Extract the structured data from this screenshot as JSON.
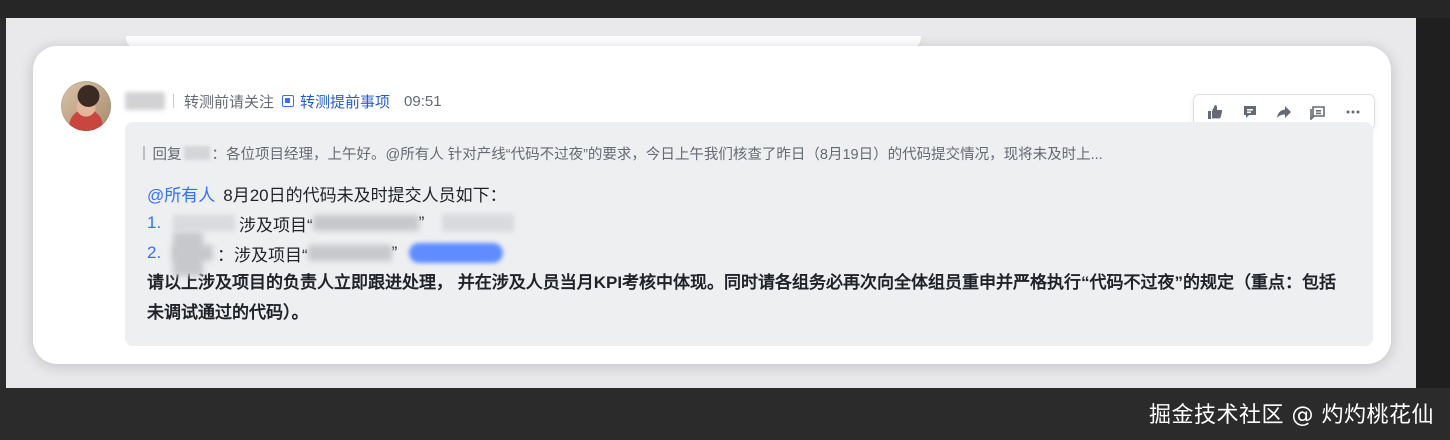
{
  "message": {
    "meta_prefix": "转测前请关注",
    "meta_link": "转测提前事项",
    "time": "09:51"
  },
  "toolbar": {
    "icons": [
      "thumbs-up-icon",
      "comment-icon",
      "forward-icon",
      "chat-bubble-icon",
      "more-icon"
    ]
  },
  "reply": {
    "prefix": "回复",
    "text": "：各位项目经理，上午好。@所有人 针对产线“代码不过夜”的要求，今日上午我们核查了昨日（8月19日）的代码提交情况，现将未及时上..."
  },
  "body": {
    "mention": "@所有人",
    "heading": "8月20日的代码未及时提交人员如下：",
    "items": [
      {
        "num": "1.",
        "text": "涉及项目“",
        "tail": "”"
      },
      {
        "num": "2.",
        "text": "：涉及项目“",
        "tail": "”"
      }
    ],
    "paragraph": "请以上涉及项目的负责人立即跟进处理， 并在涉及人员当月KPI考核中体现。同时请各组务必再次向全体组员重申并严格执行“代码不过夜”的规定（重点：包括未调试通过的代码）。"
  },
  "credit": "掘金技术社区 @ 灼灼桃花仙"
}
